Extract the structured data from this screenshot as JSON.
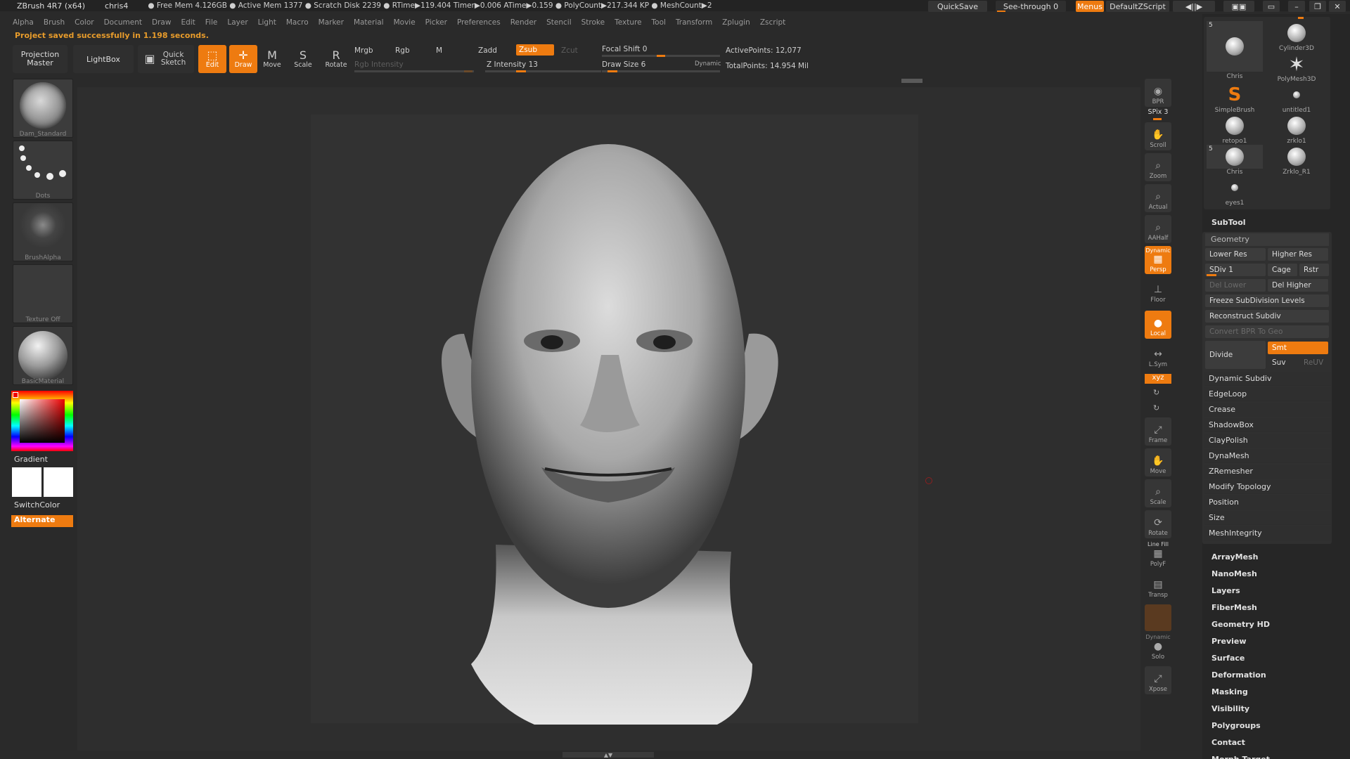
{
  "title": {
    "app": "ZBrush 4R7 (x64)",
    "doc": "chris4",
    "stats": "● Free Mem 4.126GB ● Active Mem 1377 ● Scratch Disk 2239 ● RTime▶119.404 Timer▶0.006 ATime▶0.159 ● PolyCount▶217.344 KP ● MeshCount▶2"
  },
  "titlebar": {
    "quicksave": "QuickSave",
    "seethrough": "See-through 0",
    "menus": "Menus",
    "defaultscript": "DefaultZScript"
  },
  "menus": [
    "Alpha",
    "Brush",
    "Color",
    "Document",
    "Draw",
    "Edit",
    "File",
    "Layer",
    "Light",
    "Macro",
    "Marker",
    "Material",
    "Movie",
    "Picker",
    "Preferences",
    "Render",
    "Stencil",
    "Stroke",
    "Texture",
    "Tool",
    "Transform",
    "Zplugin",
    "Zscript"
  ],
  "status": "Project saved successfully in 1.198 seconds.",
  "toolbar": {
    "projection_master": "Projection Master",
    "lightbox": "LightBox",
    "quick_sketch": "Quick Sketch",
    "edit": "Edit",
    "draw": "Draw",
    "move": "Move",
    "scale": "Scale",
    "rotate": "Rotate",
    "mrgb": "Mrgb",
    "rgb": "Rgb",
    "m": "M",
    "rgb_intensity": "Rgb Intensity",
    "zadd": "Zadd",
    "zsub": "Zsub",
    "zcut": "Zcut",
    "z_intensity": "Z Intensity 13",
    "focal_shift": "Focal Shift 0",
    "draw_size": "Draw Size 6",
    "dynamic": "Dynamic",
    "active_points": "ActivePoints: 12,077",
    "total_points": "TotalPoints: 14.954 Mil"
  },
  "lefttray": {
    "brush": "Dam_Standard",
    "stroke": "Dots",
    "alpha": "BrushAlpha",
    "texture": "Texture Off",
    "material": "BasicMaterial",
    "gradient": "Gradient",
    "switchcolor": "SwitchColor",
    "alternate": "Alternate"
  },
  "shelf": {
    "bpr": "BPR",
    "spix": "SPix 3",
    "scroll": "Scroll",
    "zoom": "Zoom",
    "actual": "Actual",
    "aahalf": "AAHalf",
    "dynamic": "Dynamic",
    "persp": "Persp",
    "floor": "Floor",
    "local": "Local",
    "lsym": "L.Sym",
    "xyz": "xyz",
    "frame": "Frame",
    "move": "Move",
    "scale": "Scale",
    "rotate": "Rotate",
    "linefill": "Line Fill",
    "polyf": "PolyF",
    "transp": "Transp",
    "dynamic2": "Dynamic",
    "solo": "Solo",
    "xpose": "Xpose"
  },
  "tools": [
    {
      "name": "Chris",
      "badge": "5"
    },
    {
      "name": "Cylinder3D",
      "badge": ""
    },
    {
      "name": "PolyMesh3D",
      "badge": ""
    },
    {
      "name": "SimpleBrush",
      "badge": ""
    },
    {
      "name": "untitled1",
      "badge": ""
    },
    {
      "name": "retopo1",
      "badge": ""
    },
    {
      "name": "zrklo1",
      "badge": ""
    },
    {
      "name": "Chris",
      "badge": "5"
    },
    {
      "name": "Zrklo_R1",
      "badge": ""
    },
    {
      "name": "eyes1",
      "badge": ""
    }
  ],
  "subtool_header": "SubTool",
  "geometry": {
    "header": "Geometry",
    "lower_res": "Lower Res",
    "higher_res": "Higher Res",
    "sdiv": "SDiv 1",
    "cage": "Cage",
    "rstr": "Rstr",
    "del_lower": "Del Lower",
    "del_higher": "Del Higher",
    "freeze": "Freeze SubDivision Levels",
    "reconstruct": "Reconstruct Subdiv",
    "convert_bpr": "Convert BPR To Geo",
    "divide": "Divide",
    "smt": "Smt",
    "suv": "Suv",
    "reuv": "ReUV"
  },
  "geometry_sub": [
    "Dynamic Subdiv",
    "EdgeLoop",
    "Crease",
    "ShadowBox",
    "ClayPolish",
    "DynaMesh",
    "ZRemesher",
    "Modify Topology",
    "Position",
    "Size",
    "MeshIntegrity"
  ],
  "tool_menus": [
    "ArrayMesh",
    "NanoMesh",
    "Layers",
    "FiberMesh",
    "Geometry HD",
    "Preview",
    "Surface",
    "Deformation",
    "Masking",
    "Visibility",
    "Polygroups",
    "Contact",
    "Morph Target"
  ]
}
